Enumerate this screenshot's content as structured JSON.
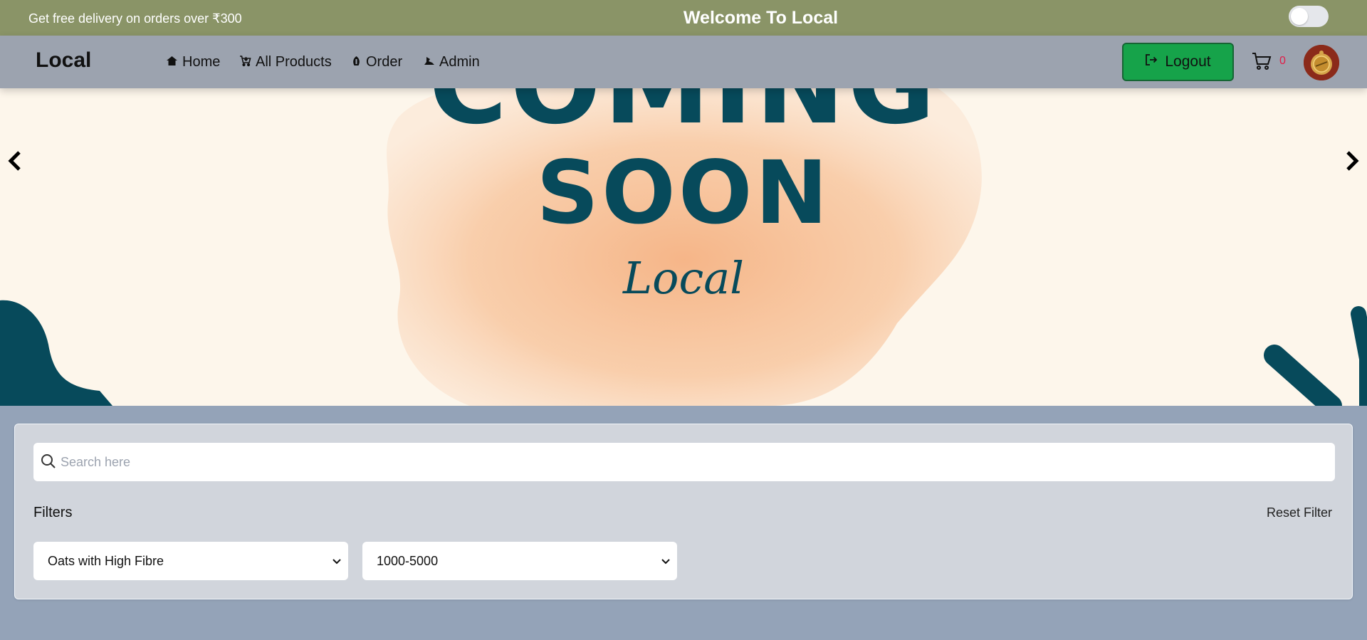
{
  "topbar": {
    "promo": "Get free delivery on orders over ₹300",
    "welcome": "Welcome To Local",
    "theme_toggle_on": false
  },
  "navbar": {
    "logo": "Local",
    "links": [
      {
        "label": "Home",
        "icon": "home-icon"
      },
      {
        "label": "All Products",
        "icon": "cart-icon"
      },
      {
        "label": "Order",
        "icon": "order-icon"
      },
      {
        "label": "Admin",
        "icon": "admin-icon"
      }
    ],
    "logout_label": "Logout",
    "cart_count": "0"
  },
  "hero": {
    "title_top": "COMING",
    "title_main": "SOON",
    "script": "Local",
    "colors": {
      "background": "#fdf6eb",
      "text": "#074a5b",
      "blob": "#f7c39a"
    }
  },
  "filters": {
    "search_placeholder": "Search here",
    "search_value": "",
    "label": "Filters",
    "reset_label": "Reset Filter",
    "category_selected": "Oats with High Fibre",
    "price_selected": "1000-5000"
  },
  "colors": {
    "topbar": "#8a9467",
    "navbar": "#9ca3af",
    "logout_button": "#16a34a",
    "cart_count": "#e11d48",
    "page_background": "#94a3b8"
  }
}
